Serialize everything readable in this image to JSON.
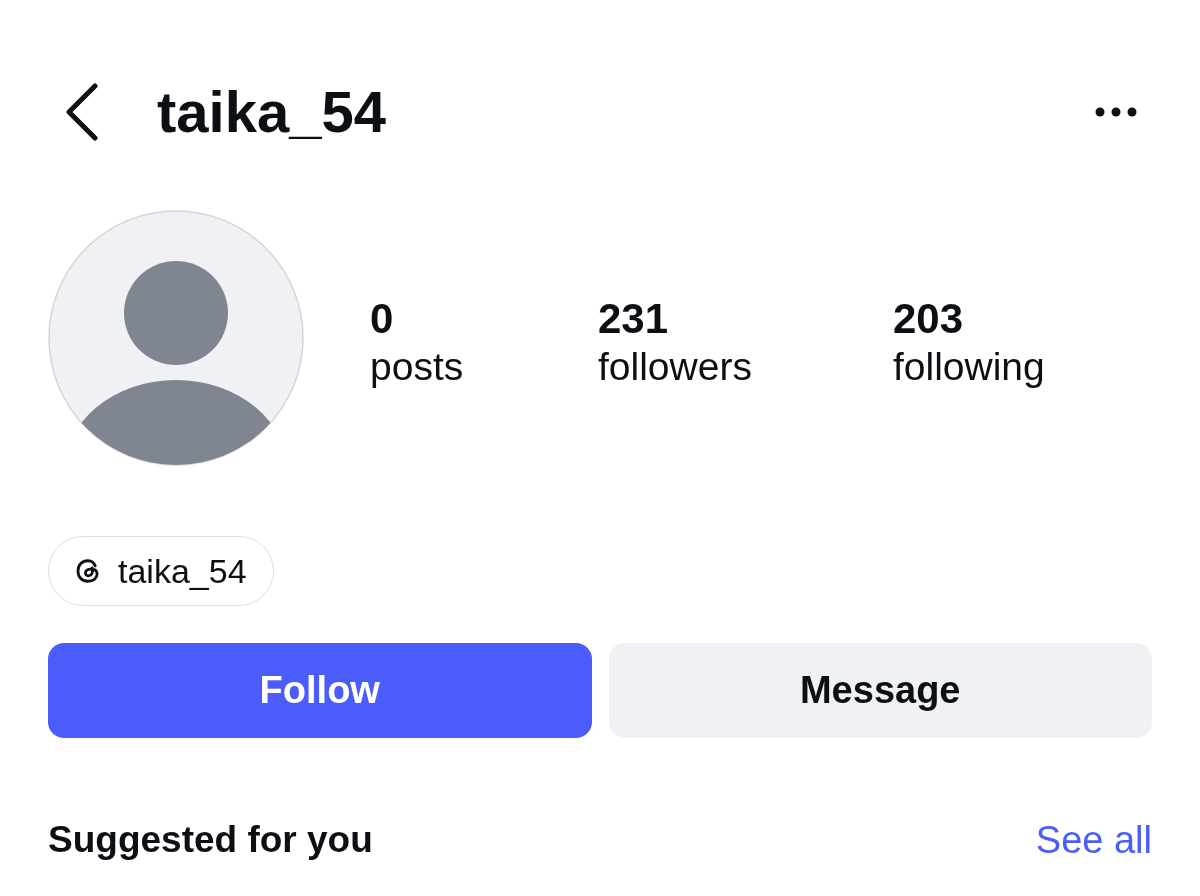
{
  "header": {
    "title": "taika_54"
  },
  "profile": {
    "stats": [
      {
        "value": "0",
        "label": "posts"
      },
      {
        "value": "231",
        "label": "followers"
      },
      {
        "value": "203",
        "label": "following"
      }
    ]
  },
  "threads_link": {
    "handle": "taika_54"
  },
  "actions": [
    {
      "label": "Follow",
      "kind": "primary"
    },
    {
      "label": "Message",
      "kind": "secondary"
    }
  ],
  "suggested": {
    "title": "Suggested for you",
    "link": "See all"
  }
}
